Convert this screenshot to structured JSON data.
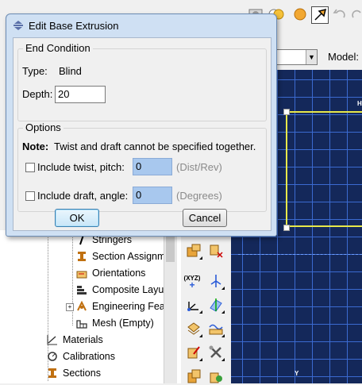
{
  "dialog": {
    "title": "Edit Base Extrusion",
    "end_condition": {
      "group_title": "End Condition",
      "type_label": "Type:",
      "type_value": "Blind",
      "depth_label": "Depth:",
      "depth_value": "20"
    },
    "options": {
      "group_title": "Options",
      "note_label": "Note:",
      "note_text": "Twist and draft cannot be specified together.",
      "twist_label": "Include twist, pitch:",
      "twist_checked": false,
      "twist_value": "0",
      "twist_unit": "(Dist/Rev)",
      "draft_label": "Include draft, angle:",
      "draft_checked": false,
      "draft_value": "0",
      "draft_unit": "(Degrees)"
    },
    "ok_label": "OK",
    "cancel_label": "Cancel"
  },
  "model_bar": {
    "label": "Model:"
  },
  "viewport": {
    "axis_y": "Y",
    "axis_h": "H"
  },
  "tree": {
    "items": [
      {
        "label": "Stringers",
        "icon": "stringer-icon"
      },
      {
        "label": "Section Assignm",
        "icon": "section-assignment-icon"
      },
      {
        "label": "Orientations",
        "icon": "orientation-icon"
      },
      {
        "label": "Composite Layu",
        "icon": "composite-layup-icon"
      },
      {
        "label": "Engineering Fea",
        "icon": "engineering-feature-icon"
      },
      {
        "label": "Mesh (Empty)",
        "icon": "mesh-icon"
      },
      {
        "label": "Materials",
        "icon": "materials-icon"
      },
      {
        "label": "Calibrations",
        "icon": "calibration-icon"
      },
      {
        "label": "Sections",
        "icon": "sections-icon"
      }
    ]
  },
  "colors": {
    "viewport_bg": "#14285a",
    "grid_line": "#3b6ad0",
    "sketch_outline": "#e8e84a",
    "dialog_frame": "#cfe0f3",
    "disabled_field": "#a8c8ee"
  }
}
